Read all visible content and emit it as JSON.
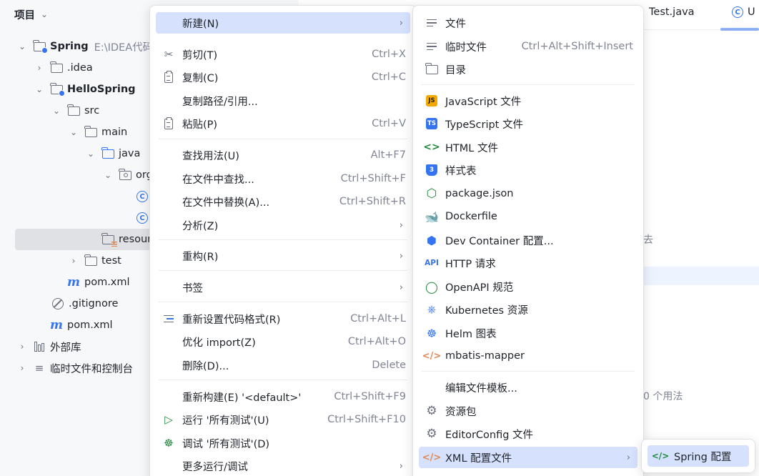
{
  "project_panel": {
    "title": "项目",
    "tree": {
      "root": {
        "name": "Spring",
        "path": "E:\\IDEA代码"
      },
      "idea": ".idea",
      "module": "HelloSpring",
      "src": "src",
      "main": "main",
      "java": "java",
      "package": "org",
      "class1": "",
      "class2": "",
      "resources": "resour",
      "test": "test",
      "module_pom": "pom.xml",
      "gitignore": ".gitignore",
      "root_pom": "pom.xml",
      "external_libraries": "外部库",
      "scratches": "临时文件和控制台"
    }
  },
  "editor": {
    "tabs": [
      {
        "label": "Test.java"
      },
      {
        "label": "U"
      }
    ],
    "background_fragments": {
      "fragment1": "去",
      "fragment2": "0 个用法"
    }
  },
  "context_menu": {
    "items": [
      {
        "label": "新建(N)",
        "mnemonic": "N",
        "has_submenu": true
      },
      {
        "label": "剪切(T)",
        "shortcut": "Ctrl+X",
        "icon": "scissors-icon"
      },
      {
        "label": "复制(C)",
        "shortcut": "Ctrl+C",
        "icon": "copy-icon"
      },
      {
        "label": "复制路径/引用..."
      },
      {
        "label": "粘贴(P)",
        "shortcut": "Ctrl+V",
        "icon": "paste-icon"
      },
      {
        "label": "查找用法(U)",
        "shortcut": "Alt+F7"
      },
      {
        "label": "在文件中查找...",
        "shortcut": "Ctrl+Shift+F"
      },
      {
        "label": "在文件中替换(A)...",
        "shortcut": "Ctrl+Shift+R"
      },
      {
        "label": "分析(Z)",
        "has_submenu": true
      },
      {
        "label": "重构(R)",
        "has_submenu": true
      },
      {
        "label": "书签",
        "has_submenu": true
      },
      {
        "label": "重新设置代码格式(R)",
        "shortcut": "Ctrl+Alt+L",
        "icon": "reformat-icon"
      },
      {
        "label": "优化 import(Z)",
        "shortcut": "Ctrl+Alt+O"
      },
      {
        "label": "删除(D)...",
        "shortcut": "Delete"
      },
      {
        "label": "重新构建(E) '<default>'",
        "shortcut": "Ctrl+Shift+F9"
      },
      {
        "label": "运行 '所有测试'(U)",
        "shortcut": "Ctrl+Shift+F10",
        "icon": "run-icon"
      },
      {
        "label": "调试 '所有测试'(D)",
        "icon": "debug-icon"
      },
      {
        "label": "更多运行/调试",
        "has_submenu": true
      }
    ]
  },
  "new_submenu": {
    "items": [
      {
        "label": "文件",
        "icon": "file-icon"
      },
      {
        "label": "临时文件",
        "shortcut": "Ctrl+Alt+Shift+Insert",
        "icon": "scratch-file-icon"
      },
      {
        "label": "目录",
        "icon": "folder-icon"
      },
      {
        "label": "JavaScript 文件",
        "icon": "javascript-icon",
        "badge": "JS"
      },
      {
        "label": "TypeScript 文件",
        "icon": "typescript-icon",
        "badge": "TS"
      },
      {
        "label": "HTML 文件",
        "icon": "html-icon"
      },
      {
        "label": "样式表",
        "icon": "css-icon"
      },
      {
        "label": "package.json",
        "icon": "nodejs-icon"
      },
      {
        "label": "Dockerfile",
        "icon": "docker-icon"
      },
      {
        "label": "Dev Container 配置...",
        "icon": "dev-container-icon"
      },
      {
        "label": "HTTP 请求",
        "icon": "api-icon",
        "badge": "API"
      },
      {
        "label": "OpenAPI 规范",
        "icon": "openapi-icon"
      },
      {
        "label": "Kubernetes 资源",
        "icon": "kubernetes-icon"
      },
      {
        "label": "Helm 图表",
        "icon": "helm-icon"
      },
      {
        "label": "mbatis-mapper",
        "icon": "xml-tag-icon"
      },
      {
        "label": "编辑文件模板..."
      },
      {
        "label": "资源包",
        "icon": "gear-icon"
      },
      {
        "label": "EditorConfig 文件",
        "icon": "gear-icon"
      },
      {
        "label": "XML 配置文件",
        "icon": "xml-tag-icon",
        "has_submenu": true
      }
    ]
  },
  "xml_submenu": {
    "items": [
      {
        "label": "Spring 配置",
        "icon": "spring-xml-icon"
      }
    ]
  },
  "colors": {
    "accent": "#3574f0",
    "selection": "#d5e1fd",
    "panel_bg": "#f7f8fa",
    "menu_bg": "#ffffff"
  }
}
